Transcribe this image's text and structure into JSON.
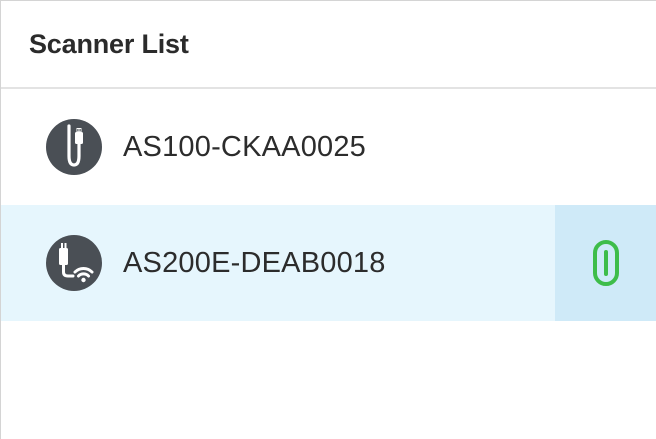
{
  "header": {
    "title": "Scanner List"
  },
  "scanners": [
    {
      "name": "AS100-CKAA0025",
      "connection": "usb",
      "icon": "usb-scanner-icon",
      "selected": false,
      "linked": false
    },
    {
      "name": "AS200E-DEAB0018",
      "connection": "wifi",
      "icon": "wifi-scanner-icon",
      "selected": true,
      "linked": true,
      "link_icon": "link-icon",
      "link_color": "#3ebd4a"
    }
  ],
  "colors": {
    "selected_row_bg": "#e6f6fd",
    "link_cell_bg": "#cfeaf8",
    "icon_dark": "#4a4f55",
    "link_green": "#3ebd4a"
  }
}
